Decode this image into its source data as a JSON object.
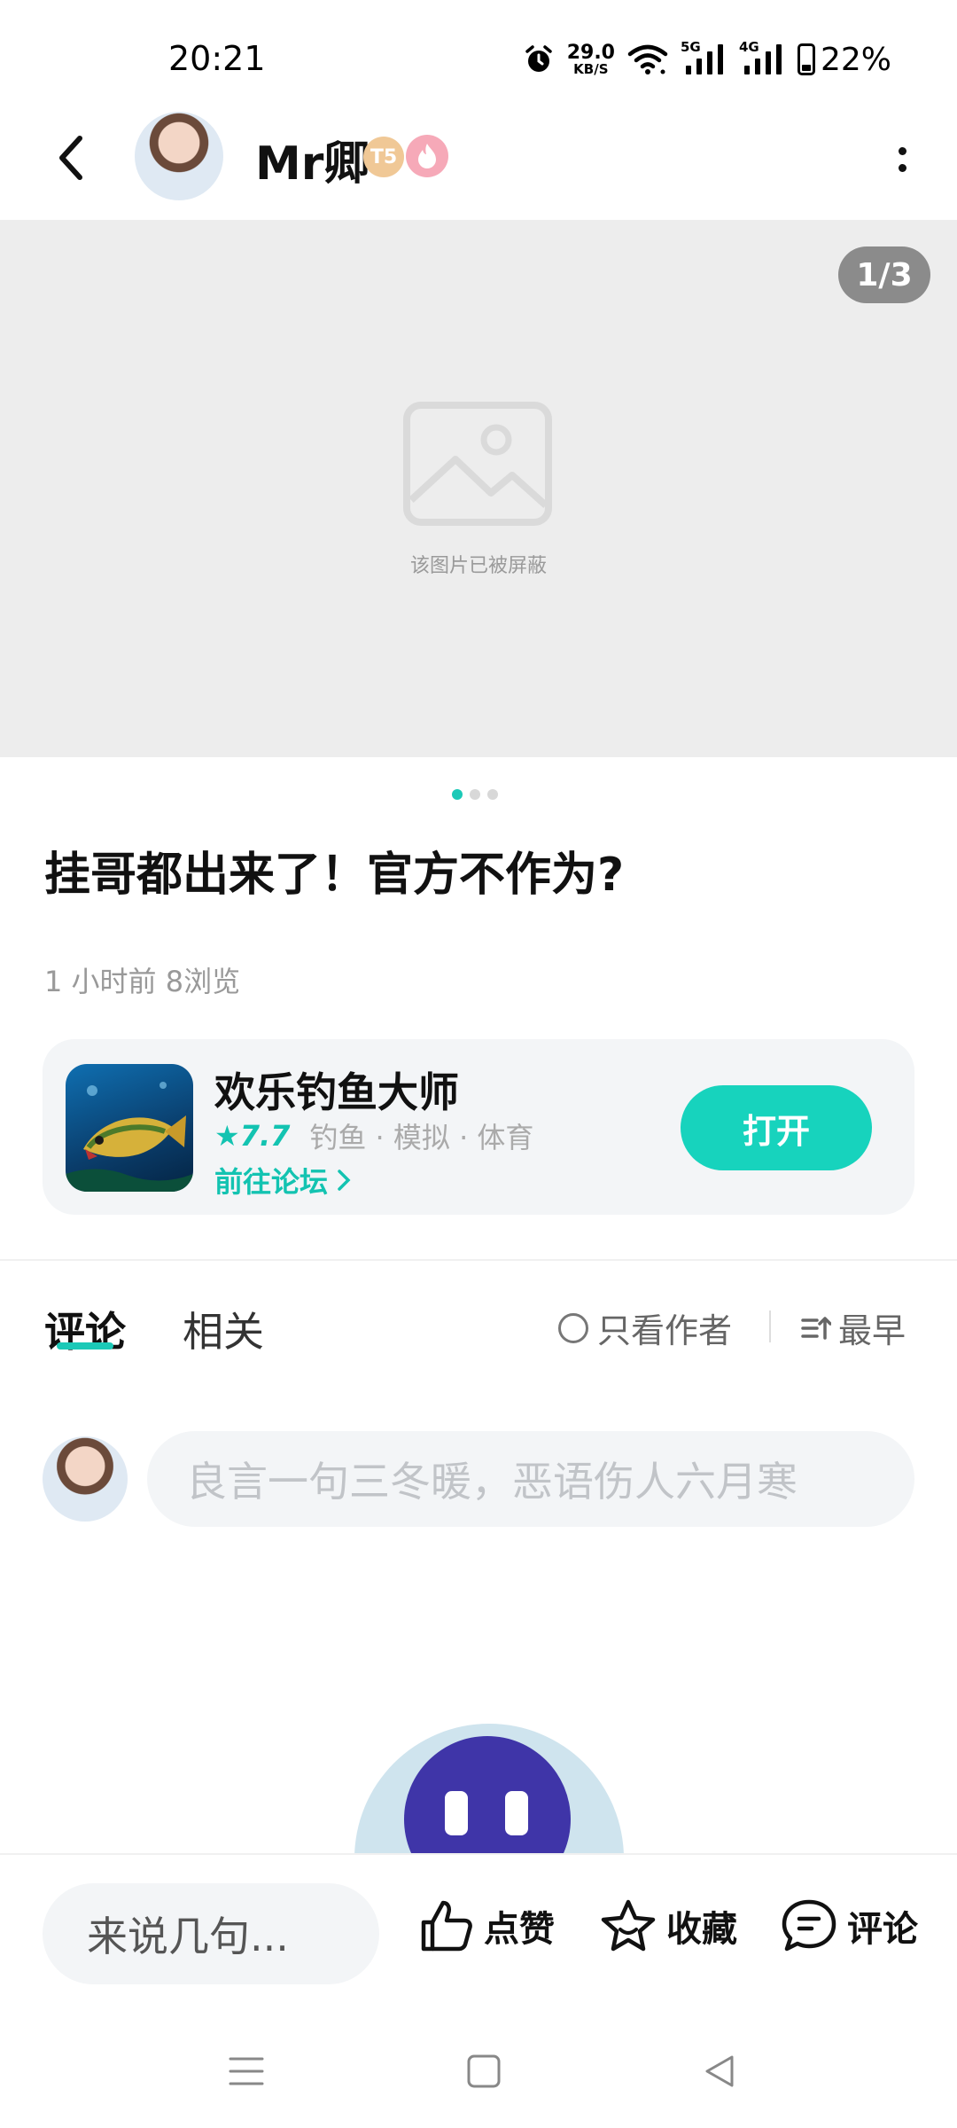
{
  "status_bar": {
    "time": "20:21",
    "net_speed_value": "29.0",
    "net_speed_unit": "KB/S",
    "signal_1": "5G",
    "signal_2": "4G",
    "battery": "22%"
  },
  "header": {
    "author_name": "Mr卿",
    "badge_level": "T5",
    "icons": [
      "back-icon",
      "more-icon"
    ]
  },
  "gallery": {
    "counter": "1/3",
    "placeholder_text": "该图片已被屏蔽",
    "page_count": 3,
    "active_page": 1
  },
  "post": {
    "title": "挂哥都出来了！官方不作为?",
    "meta": "1 小时前  8浏览"
  },
  "game_card": {
    "name": "欢乐钓鱼大师",
    "rating": "★7.7",
    "tags": "钓鱼 · 模拟 · 体育",
    "forum_link": "前往论坛",
    "open_button": "打开"
  },
  "tabs": {
    "comments": "评论",
    "related": "相关",
    "author_only": "只看作者",
    "sort": "最早"
  },
  "comment_box": {
    "placeholder": "良言一句三冬暖，恶语伤人六月寒"
  },
  "bottom_bar": {
    "input_placeholder": "来说几句...",
    "like": "点赞",
    "favorite": "收藏",
    "comment": "评论"
  },
  "colors": {
    "accent": "#17d3bd",
    "accent_text": "#13c3b1"
  }
}
